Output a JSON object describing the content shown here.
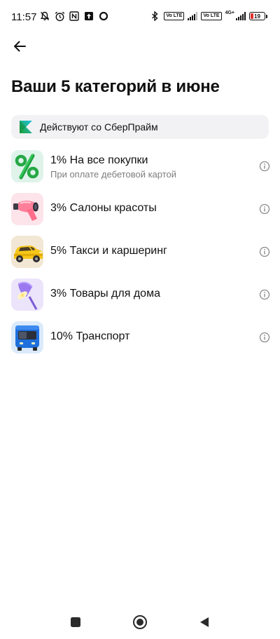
{
  "status_bar": {
    "time": "11:57",
    "left_icons": [
      "muted-bell-icon",
      "alarm-icon",
      "nfc-icon",
      "upload-icon",
      "circle-icon"
    ],
    "right_icons": [
      "bluetooth-icon",
      "volte-icon",
      "signal-icon",
      "volte-icon",
      "signal-icon"
    ],
    "volte_label": "Vo LTE",
    "network_type": "4G+",
    "battery_level": "19",
    "battery_color": "#e0312d"
  },
  "header": {
    "back_icon": "arrow-left-icon"
  },
  "page": {
    "title": "Ваши 5 категорий в июне"
  },
  "prime_banner": {
    "text": "Действуют со СберПрайм",
    "logo_colors": [
      "#21a038",
      "#1ec2e0"
    ]
  },
  "categories": [
    {
      "title": "1% На все покупки",
      "subtitle": "При оплате дебетовой картой",
      "icon": "percent-icon",
      "bg": "#dff3ea"
    },
    {
      "title": "3% Салоны красоты",
      "subtitle": "",
      "icon": "hair-dryer-icon",
      "bg": "#fde3ea"
    },
    {
      "title": "5% Такси и каршеринг",
      "subtitle": "",
      "icon": "taxi-car-icon",
      "bg": "#f2e7d4"
    },
    {
      "title": "3% Товары для дома",
      "subtitle": "",
      "icon": "lamp-icon",
      "bg": "#ece4fb"
    },
    {
      "title": "10% Транспорт",
      "subtitle": "",
      "icon": "bus-icon",
      "bg": "#dbeafb"
    }
  ],
  "nav_bar": {
    "icons": [
      "recents-square-icon",
      "home-circle-icon",
      "back-triangle-icon"
    ]
  }
}
